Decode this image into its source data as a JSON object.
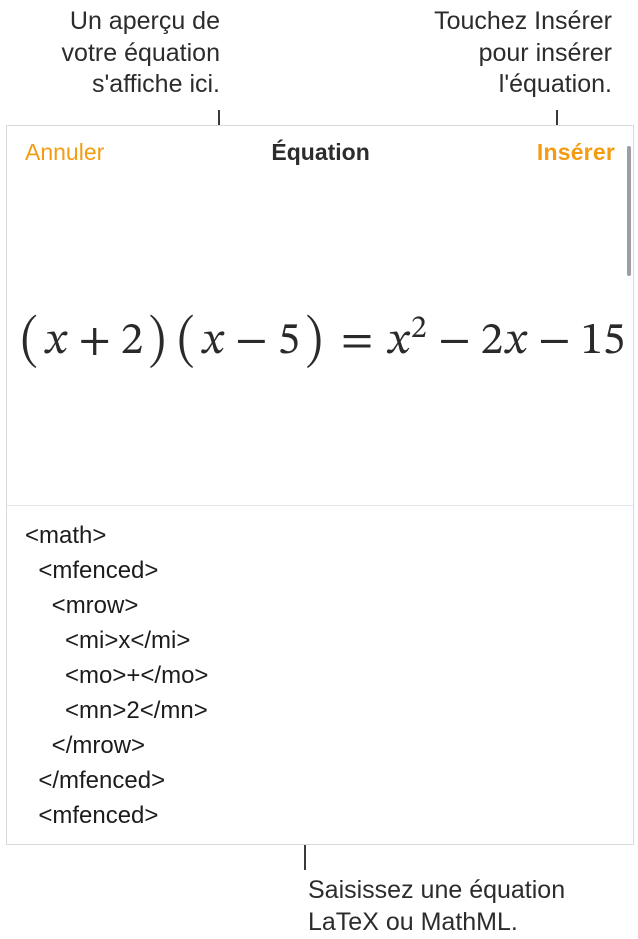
{
  "callouts": {
    "preview": "Un aperçu de\nvotre équation\ns'affiche ici.",
    "insert": "Touchez Insérer\npour insérer\nl'équation.",
    "input": "Saisissez une équation\nLaTeX ou MathML."
  },
  "titlebar": {
    "cancel": "Annuler",
    "title": "Équation",
    "insert": "Insérer"
  },
  "equation": {
    "display": "(x + 2)(x − 5) = x² − 2x − 15",
    "terms": {
      "lparen1": "(",
      "x1": "x",
      "plus": "+",
      "two": "2",
      "rparen1": ")",
      "lparen2": "(",
      "x2": "x",
      "minus1": "−",
      "five": "5",
      "rparen2": ")",
      "eq": "=",
      "x3": "x",
      "sq": "2",
      "minus2": "−",
      "coef": "2",
      "x4": "x",
      "minus3": "−",
      "fifteen": "15"
    }
  },
  "editor": {
    "content": "<math>\n  <mfenced>\n    <mrow>\n      <mi>x</mi>\n      <mo>+</mo>\n      <mn>2</mn>\n    </mrow>\n  </mfenced>\n  <mfenced>\n    <mrow>"
  },
  "colors": {
    "accent": "#f39c12"
  }
}
